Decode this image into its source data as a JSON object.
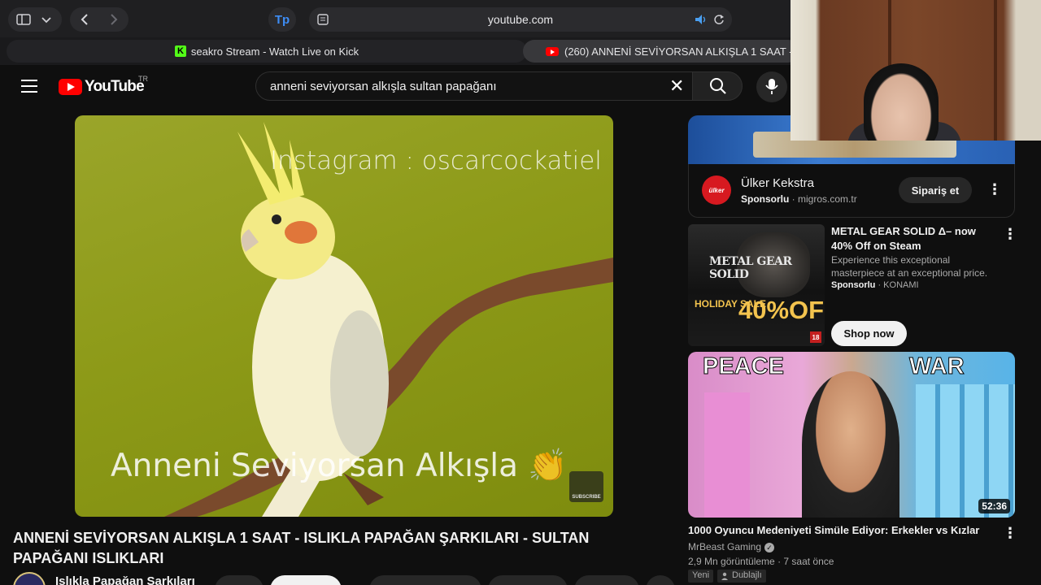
{
  "browser": {
    "url": "youtube.com",
    "tabs": [
      {
        "label": "seakro Stream - Watch Live on Kick",
        "icon": "kick-icon"
      },
      {
        "label": "(260) ANNENİ SEVİYORSAN ALKIŞLA 1 SAAT -",
        "icon": "youtube-icon"
      }
    ]
  },
  "header": {
    "logo_text": "YouTube",
    "country": "TR",
    "search_value": "anneni seviyorsan alkışla sultan papağanı"
  },
  "video": {
    "overlay_top": "Instagram : oscarcockatiel",
    "overlay_bottom": "Anneni Seviyorsan Alkışla 👏",
    "badge": "SUBSCRIBE",
    "title": "ANNENİ SEVİYORSAN ALKIŞLA 1 SAAT - ISLIKLA PAPAĞAN ŞARKILARI - SULTAN PAPAĞANI ISLIKLARI",
    "channel": "Islıkla Papağan Şarkıları"
  },
  "sidebar": {
    "ad1": {
      "brand_logo": "ülker",
      "name": "Ülker Kekstra",
      "sponsored": "Sponsorlu",
      "domain": "migros.com.tr",
      "cta": "Sipariş et"
    },
    "ad2": {
      "thumb_logo": "METAL GEAR SOLID",
      "thumb_sale": "HOLIDAY SALE",
      "thumb_pct": "40%OFF",
      "thumb_rating": "18",
      "title": "METAL GEAR SOLID Δ– now 40% Off on Steam",
      "description": "Experience this exceptional masterpiece at an exceptional price.",
      "sponsored": "Sponsorlu",
      "advertiser": "KONAMI",
      "cta": "Shop now"
    },
    "rec1": {
      "thumb_left": "PEACE",
      "thumb_right": "WAR",
      "duration": "52:36",
      "title": "1000 Oyuncu Medeniyeti Simüle Ediyor: Erkekler vs Kızlar",
      "channel": "MrBeast Gaming",
      "views": "2,9 Mn görüntüleme",
      "age": "7 saat önce",
      "tag_new": "Yeni",
      "tag_dub": "Dublajlı"
    }
  },
  "colors": {
    "background": "#0f0f0f",
    "brand_red": "#ff0000",
    "kick_green": "#53fc18"
  }
}
